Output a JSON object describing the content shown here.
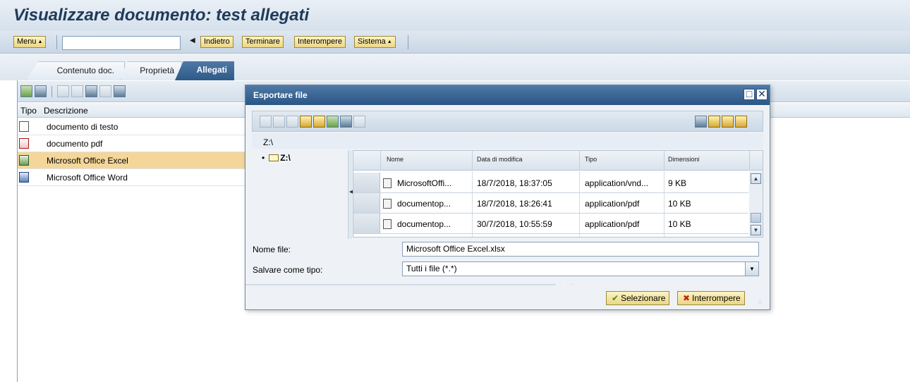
{
  "title": "Visualizzare documento: test allegati",
  "toolbar": {
    "menu_label": "Menu",
    "command_field_value": "",
    "back_label": "Indietro",
    "exit_label": "Terminare",
    "cancel_label": "Interrompere",
    "system_label": "Sistema"
  },
  "tabs": [
    {
      "label": "Contenuto doc.",
      "active": false
    },
    {
      "label": "Proprietà",
      "active": false
    },
    {
      "label": "Allegati",
      "active": true
    }
  ],
  "attachments": {
    "columns": [
      "Tipo",
      "Descrizione"
    ],
    "rows": [
      {
        "icon": "text-document-icon",
        "label": "documento di testo",
        "selected": false
      },
      {
        "icon": "pdf-icon",
        "label": "documento pdf",
        "selected": false
      },
      {
        "icon": "excel-icon",
        "label": "Microsoft Office Excel",
        "selected": true
      },
      {
        "icon": "word-icon",
        "label": "Microsoft Office Word",
        "selected": false
      }
    ]
  },
  "dialog": {
    "title": "Esportare file",
    "path": "Z:\\",
    "tree_root": "Z:\\",
    "columns": [
      "Nome",
      "Data di modifica",
      "Tipo",
      "Dimensioni"
    ],
    "files": [
      {
        "name": "MicrosoftOffi...",
        "modified": "18/7/2018, 18:37:05",
        "type": "application/vnd...",
        "size": "9 KB"
      },
      {
        "name": "documentop...",
        "modified": "18/7/2018, 18:26:41",
        "type": "application/pdf",
        "size": "10 KB"
      },
      {
        "name": "documentop...",
        "modified": "30/7/2018, 10:55:59",
        "type": "application/pdf",
        "size": "10 KB"
      }
    ],
    "filename_label": "Nome file:",
    "filename_value": "Microsoft Office Excel.xlsx",
    "filetype_label": "Salvare come tipo:",
    "filetype_value": "Tutti i file (*.*)",
    "select_label": "Selezionare",
    "cancel_label": "Interrompere"
  },
  "colors": {
    "accent": "#2e5a88",
    "selected_row": "#f4d69a",
    "button_gold": "#ecd685"
  }
}
